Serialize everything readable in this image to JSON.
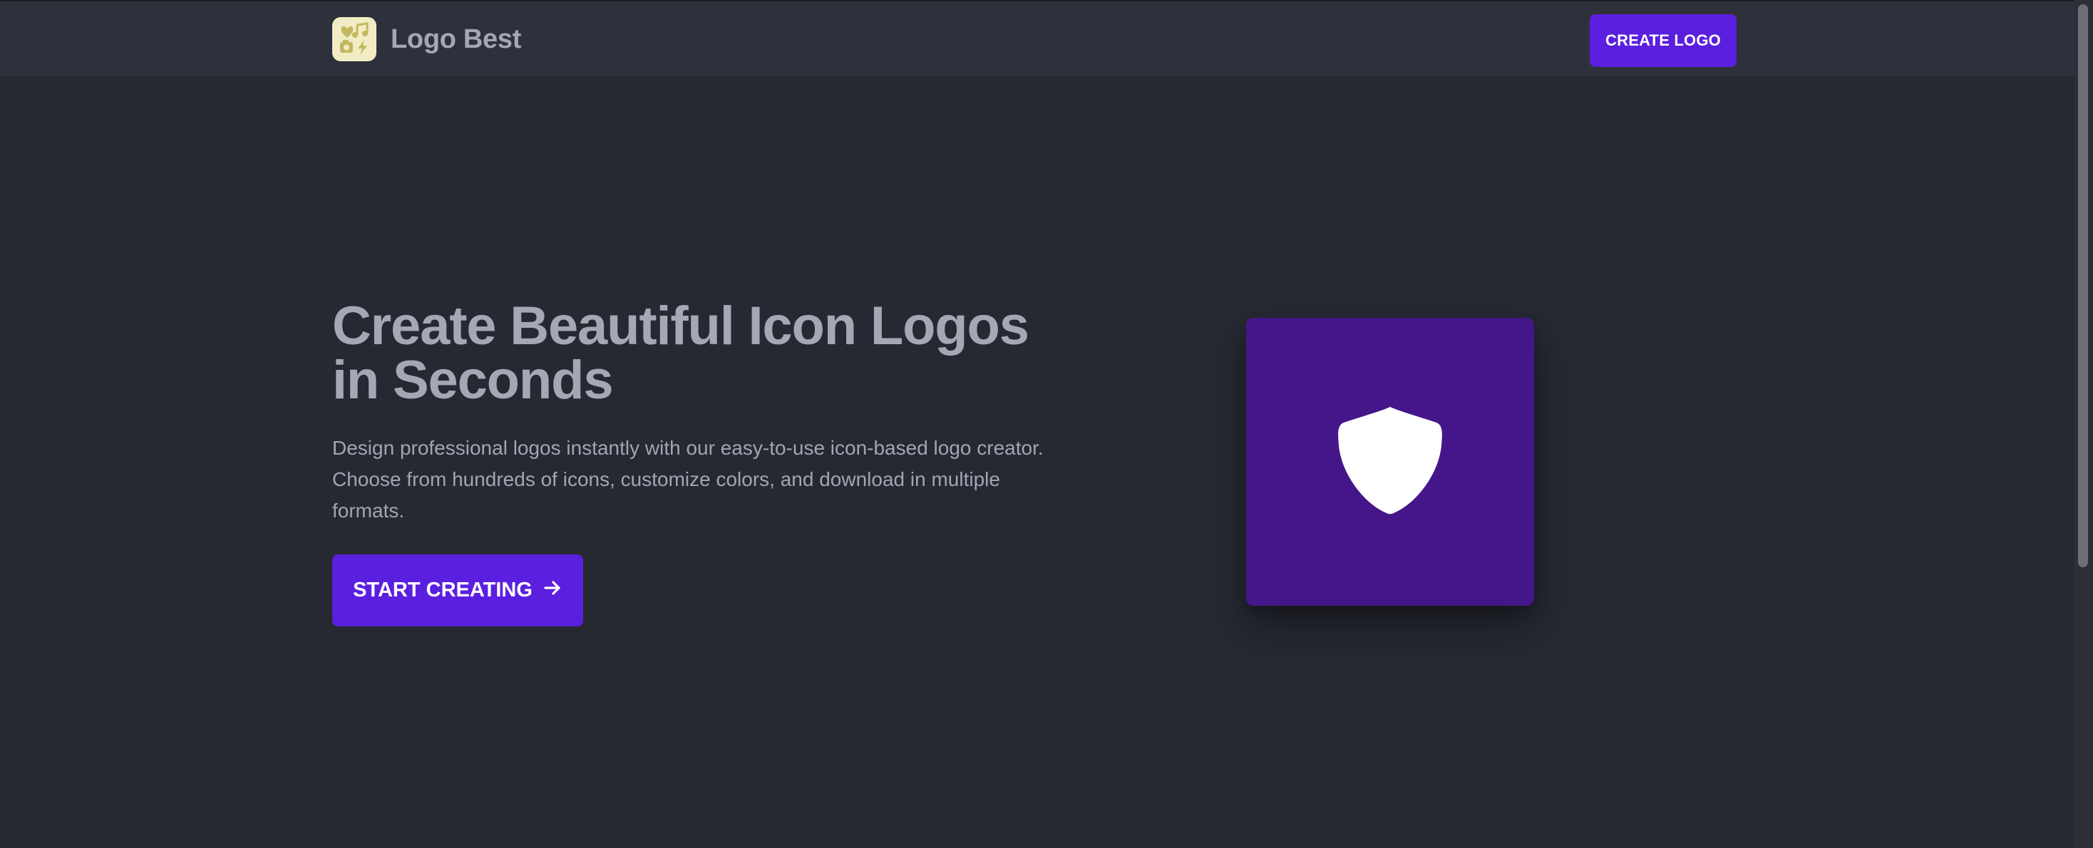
{
  "header": {
    "brand_name": "Logo Best",
    "brand_icon": "music-heart-bolt-icon",
    "create_logo_label": "CREATE LOGO"
  },
  "hero": {
    "title": "Create Beautiful Icon Logos in Seconds",
    "description": "Design professional logos instantly with our easy-to-use icon-based logo creator. Choose from hundreds of icons, customize colors, and download in multiple formats.",
    "cta_label": "START CREATING",
    "cta_icon": "arrow-right-icon"
  },
  "preview": {
    "icon": "shield-icon",
    "background_color": "#45168a",
    "icon_color": "#ffffff"
  },
  "colors": {
    "page_bg": "#262932",
    "header_bg": "#2e313b",
    "accent": "#5b1fe0",
    "brand_icon_bg": "#f1ecc4",
    "text_muted": "#a3a8b4"
  }
}
